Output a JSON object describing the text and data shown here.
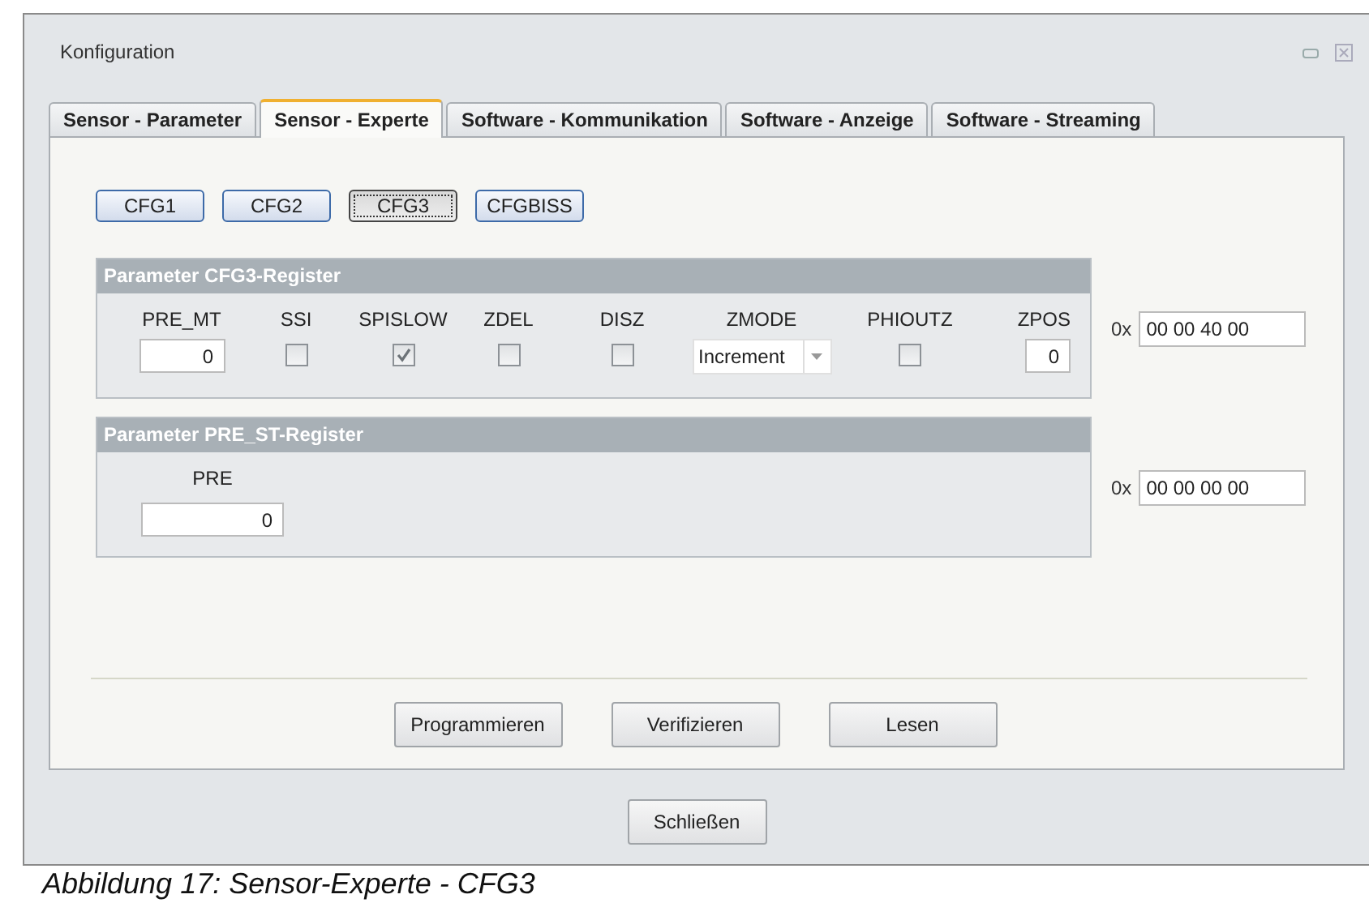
{
  "window": {
    "title": "Konfiguration"
  },
  "tabs": [
    {
      "label": "Sensor - Parameter",
      "selected": false
    },
    {
      "label": "Sensor - Experte",
      "selected": true
    },
    {
      "label": "Software - Kommunikation",
      "selected": false
    },
    {
      "label": "Software - Anzeige",
      "selected": false
    },
    {
      "label": "Software - Streaming",
      "selected": false
    }
  ],
  "register_buttons": [
    {
      "label": "CFG1",
      "selected": false
    },
    {
      "label": "CFG2",
      "selected": false
    },
    {
      "label": "CFG3",
      "selected": true
    },
    {
      "label": "CFGBISS",
      "selected": false
    }
  ],
  "groups": [
    {
      "title": "Parameter CFG3-Register",
      "fields": [
        {
          "kind": "number",
          "label": "PRE_MT",
          "value": "0"
        },
        {
          "kind": "checkbox",
          "label": "SSI",
          "checked": false
        },
        {
          "kind": "checkbox",
          "label": "SPISLOW",
          "checked": true
        },
        {
          "kind": "checkbox",
          "label": "ZDEL",
          "checked": false
        },
        {
          "kind": "checkbox",
          "label": "DISZ",
          "checked": false
        },
        {
          "kind": "dropdown",
          "label": "ZMODE",
          "value": "Increment"
        },
        {
          "kind": "checkbox",
          "label": "PHIOUTZ",
          "checked": false
        },
        {
          "kind": "number",
          "label": "ZPOS",
          "value": "0"
        }
      ],
      "hex_prefix": "0x",
      "hex_value": "00 00 40 00"
    },
    {
      "title": "Parameter PRE_ST-Register",
      "fields": [
        {
          "kind": "number",
          "label": "PRE",
          "value": "0"
        }
      ],
      "hex_prefix": "0x",
      "hex_value": "00 00 00 00"
    }
  ],
  "action_buttons": [
    "Programmieren",
    "Verifizieren",
    "Lesen"
  ],
  "close_button": "Schließen",
  "caption": "Abbildung 17: Sensor-Experte - CFG3"
}
